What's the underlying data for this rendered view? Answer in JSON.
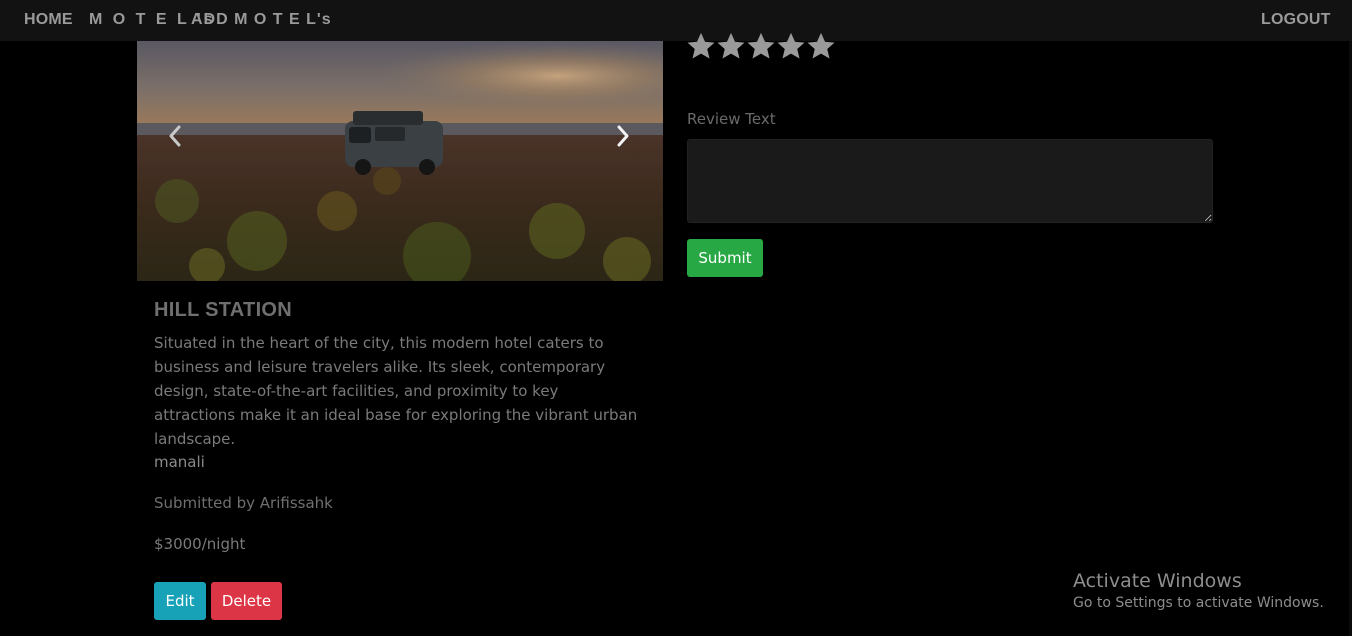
{
  "navbar": {
    "home": "HOME",
    "motels": "M O T E L 's",
    "add_motels": "ADD M O T E L's",
    "logout": "LOGOUT"
  },
  "motel": {
    "title": "HILL STATION",
    "description": "Situated in the heart of the city, this modern hotel caters to business and leisure travelers alike. Its sleek, contemporary design, state-of-the-art facilities, and proximity to key attractions make it an ideal base for exploring the vibrant urban landscape.",
    "location": "manali",
    "submitted_by": "Submitted by Arifissahk",
    "price": "$3000/night",
    "edit_label": "Edit",
    "delete_label": "Delete"
  },
  "review": {
    "stars": 5,
    "label": "Review Text",
    "textarea_value": "",
    "submit_label": "Submit"
  },
  "watermark": {
    "title": "Activate Windows",
    "subtitle": "Go to Settings to activate Windows."
  },
  "colors": {
    "edit": "#17a2b8",
    "delete": "#dc3545",
    "submit": "#28a745"
  }
}
